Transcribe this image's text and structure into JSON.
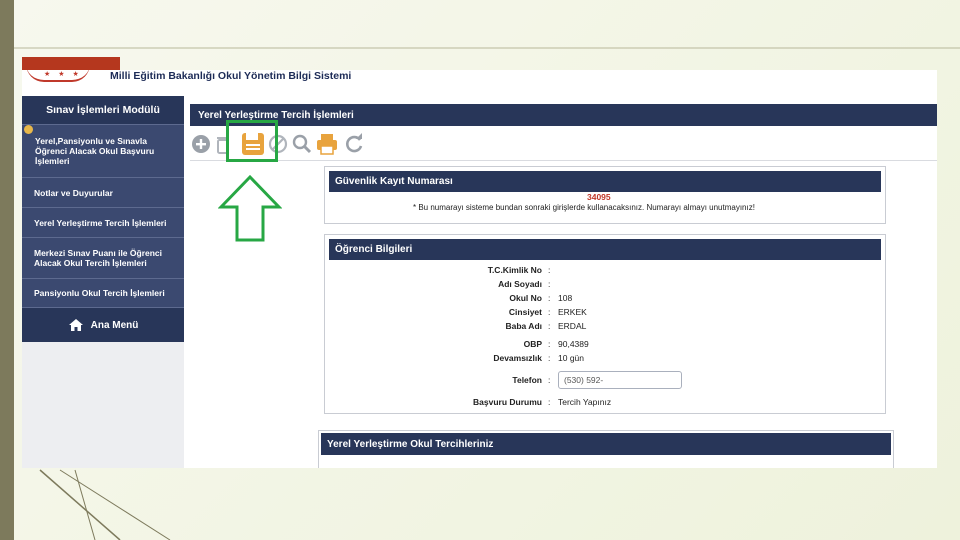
{
  "app": {
    "title": "Milli Eğitim Bakanlığı Okul Yönetim Bilgi Sistemi",
    "emblem_stars": "★ ★ ★"
  },
  "sidebar": {
    "header": "Sınav İşlemleri Modülü",
    "items": [
      {
        "label": "Yerel,Pansiyonlu ve Sınavla Öğrenci Alacak Okul Başvuru İşlemleri"
      },
      {
        "label": "Notlar ve Duyurular"
      },
      {
        "label": "Yerel Yerleştirme Tercih İşlemleri"
      },
      {
        "label": "Merkezi Sınav Puanı ile Öğrenci Alacak Okul Tercih İşlemleri"
      },
      {
        "label": "Pansiyonlu Okul Tercih İşlemleri"
      }
    ],
    "home": "Ana Menü"
  },
  "main": {
    "header": "Yerel Yerleştirme Tercih İşlemleri",
    "toolbar": [
      "add-icon",
      "delete-icon",
      "save-icon",
      "cancel-icon",
      "search-icon",
      "print-icon",
      "refresh-icon"
    ]
  },
  "security": {
    "header": "Güvenlik Kayıt Numarası",
    "number": "34095",
    "note": "* Bu numarayı sisteme bundan sonraki girişlerde kullanacaksınız. Numarayı almayı unutmayınız!"
  },
  "student": {
    "header": "Öğrenci Bilgileri",
    "fields": [
      {
        "label": "T.C.Kimlik No",
        "value": ""
      },
      {
        "label": "Adı Soyadı",
        "value": ""
      },
      {
        "label": "Okul No",
        "value": "108"
      },
      {
        "label": "Cinsiyet",
        "value": "ERKEK"
      },
      {
        "label": "Baba Adı",
        "value": "ERDAL"
      },
      {
        "label": "OBP",
        "value": "90,4389"
      },
      {
        "label": "Devamsızlık",
        "value": "10 gün"
      },
      {
        "label": "Telefon",
        "value": "(530) 592-"
      },
      {
        "label": "Başvuru Durumu",
        "value": "Tercih Yapınız"
      }
    ]
  },
  "preferences": {
    "header": "Yerel Yerleştirme Okul Tercihleriniz"
  },
  "colors": {
    "nav_dark": "#283659",
    "nav_item": "#3b4970",
    "highlight_green": "#27a744",
    "accent_orange": "#e8a33d",
    "slide_red": "#b5371e"
  }
}
